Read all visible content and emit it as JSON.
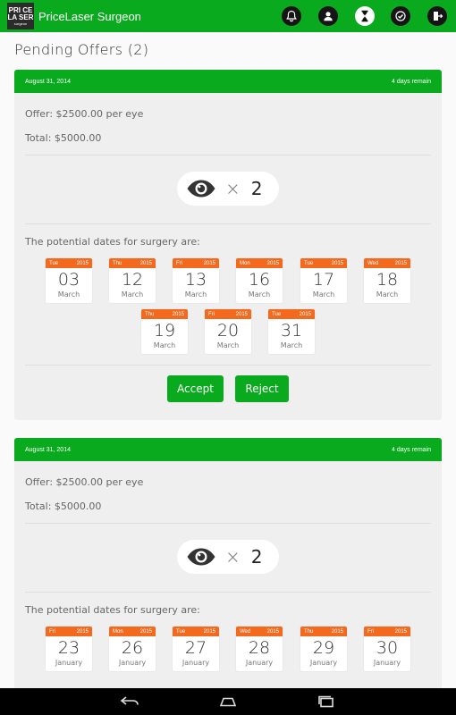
{
  "app": {
    "title": "PriceLaser Surgeon",
    "logo_lines": [
      "PRI CE",
      "LA SER",
      "surgeon"
    ]
  },
  "colors": {
    "brand_green": "#0aaa1f",
    "calendar_orange": "#f36a1e"
  },
  "nav_icons": [
    "bell-icon",
    "profile-icon",
    "hourglass-icon",
    "checkmark-icon",
    "logout-icon"
  ],
  "page": {
    "title": "Pending Offers (2)"
  },
  "offers": [
    {
      "date": "August 31, 2014",
      "remaining": "4 days remain",
      "offer": "Offer: $2500.00 per eye",
      "total": "Total: $5000.00",
      "times": "×",
      "eyes": "2",
      "dates_label": "The potential dates for surgery are:",
      "dates": [
        {
          "dow": "Tue",
          "year": "2015",
          "day": "03",
          "month": "March"
        },
        {
          "dow": "Thu",
          "year": "2015",
          "day": "12",
          "month": "March"
        },
        {
          "dow": "Fri",
          "year": "2015",
          "day": "13",
          "month": "March"
        },
        {
          "dow": "Mon",
          "year": "2015",
          "day": "16",
          "month": "March"
        },
        {
          "dow": "Tue",
          "year": "2015",
          "day": "17",
          "month": "March"
        },
        {
          "dow": "Wed",
          "year": "2015",
          "day": "18",
          "month": "March"
        },
        {
          "dow": "Thu",
          "year": "2015",
          "day": "19",
          "month": "March"
        },
        {
          "dow": "Fri",
          "year": "2015",
          "day": "20",
          "month": "March"
        },
        {
          "dow": "Tue",
          "year": "2015",
          "day": "31",
          "month": "March"
        }
      ],
      "accept_label": "Accept",
      "reject_label": "Reject"
    },
    {
      "date": "August 31, 2014",
      "remaining": "4 days remain",
      "offer": "Offer: $2500.00 per eye",
      "total": "Total: $5000.00",
      "times": "×",
      "eyes": "2",
      "dates_label": "The potential dates for surgery are:",
      "dates": [
        {
          "dow": "Fri",
          "year": "2015",
          "day": "23",
          "month": "January"
        },
        {
          "dow": "Mon",
          "year": "2015",
          "day": "26",
          "month": "January"
        },
        {
          "dow": "Tue",
          "year": "2015",
          "day": "27",
          "month": "January"
        },
        {
          "dow": "Wed",
          "year": "2015",
          "day": "28",
          "month": "January"
        },
        {
          "dow": "Thu",
          "year": "2015",
          "day": "29",
          "month": "January"
        },
        {
          "dow": "Fri",
          "year": "2015",
          "day": "30",
          "month": "January"
        }
      ]
    }
  ],
  "system_nav": [
    "back-icon",
    "home-icon",
    "recents-icon"
  ]
}
